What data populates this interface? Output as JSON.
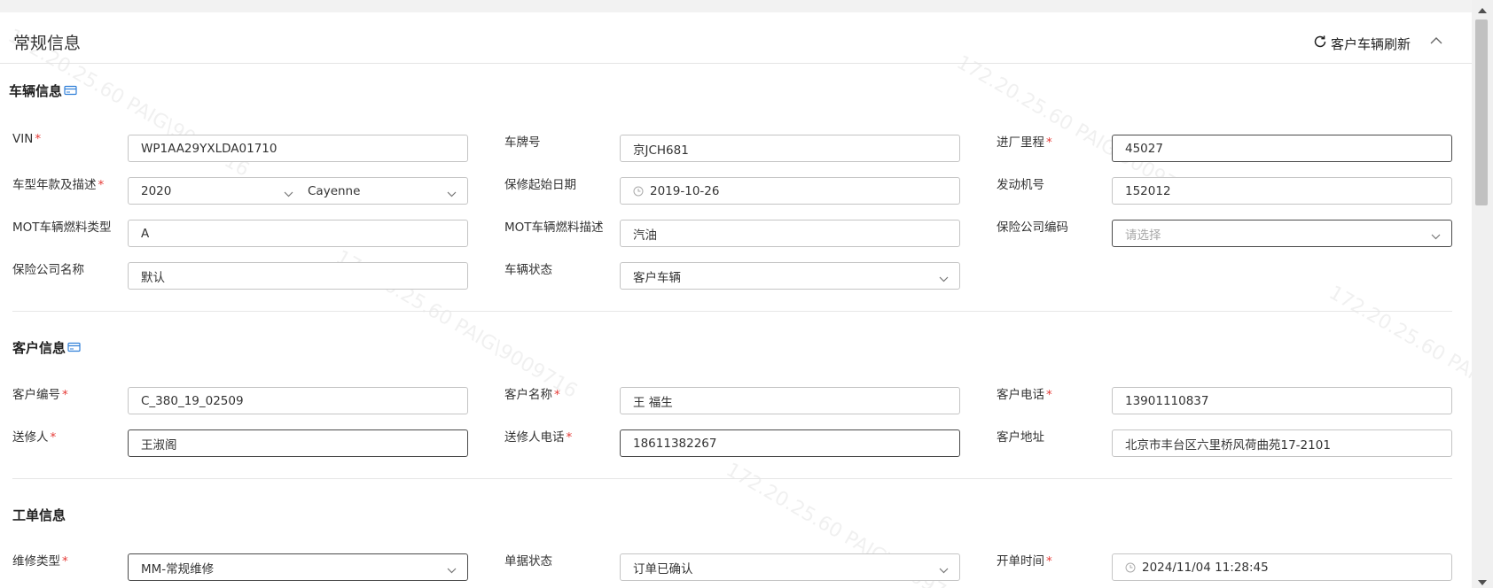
{
  "panel": {
    "title": "常规信息",
    "refresh_label": "客户车辆刷新"
  },
  "watermark": "172.20.25.60 PAIG\\9009716",
  "vehicle": {
    "title": "车辆信息",
    "vin": {
      "label": "VIN",
      "value": "WP1AA29YXLDA01710"
    },
    "plate": {
      "label": "车牌号",
      "value": "京JCH681"
    },
    "mileage": {
      "label": "进厂里程",
      "value": "45027"
    },
    "model": {
      "label": "车型年款及描述",
      "year": "2020",
      "desc": "Cayenne"
    },
    "warranty": {
      "label": "保修起始日期",
      "value": "2019-10-26"
    },
    "engine": {
      "label": "发动机号",
      "value": "152012"
    },
    "fuel_type": {
      "label": "MOT车辆燃料类型",
      "value": "A"
    },
    "fuel_desc": {
      "label": "MOT车辆燃料描述",
      "value": "汽油"
    },
    "insurer_code": {
      "label": "保险公司编码",
      "placeholder": "请选择"
    },
    "insurer_name": {
      "label": "保险公司名称",
      "value": "默认"
    },
    "status": {
      "label": "车辆状态",
      "value": "客户车辆"
    }
  },
  "customer": {
    "title": "客户信息",
    "code": {
      "label": "客户编号",
      "value": "C_380_19_02509"
    },
    "name": {
      "label": "客户名称",
      "value": "王 福生"
    },
    "phone": {
      "label": "客户电话",
      "value": "13901110837"
    },
    "sender": {
      "label": "送修人",
      "value": "王淑阁"
    },
    "sender_phone": {
      "label": "送修人电话",
      "value": "18611382267"
    },
    "address": {
      "label": "客户地址",
      "value": "北京市丰台区六里桥风荷曲苑17-2101"
    }
  },
  "order": {
    "title": "工单信息",
    "repair_type": {
      "label": "维修类型",
      "value": "MM-常规维修"
    },
    "doc_status": {
      "label": "单据状态",
      "value": "订单已确认"
    },
    "open_time": {
      "label": "开单时间",
      "value": "2024/11/04 11:28:45"
    }
  },
  "required_mark": "*"
}
